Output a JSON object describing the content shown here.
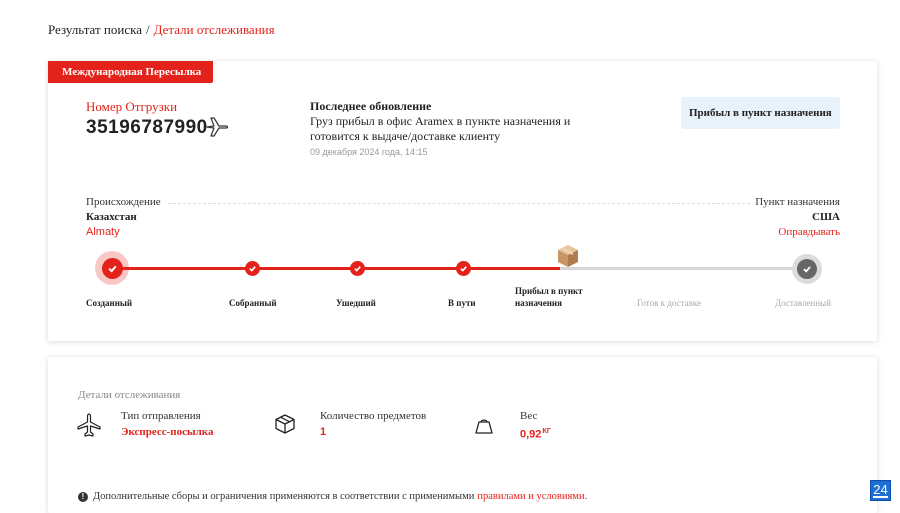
{
  "breadcrumb": {
    "parent": "Результат поиска",
    "separator": "/",
    "current": "Детали отслеживания"
  },
  "shipment_card": {
    "tag": "Международная Пересылка",
    "shipment_label": "Номер Отгрузки",
    "shipment_number": "35196787990",
    "last_update": {
      "title": "Последнее обновление",
      "text": "Груз прибыл в офис Aramex в пункте назначения и готовится к выдаче/доставке клиенту",
      "date": "09 декабря 2024 года, 14:15"
    },
    "status_badge": "Прибыл в пункт назначения",
    "origin": {
      "label": "Происхождение",
      "country": "Казахстан",
      "city": "Almaty"
    },
    "destination": {
      "label": "Пункт назначения",
      "country": "США",
      "city": "Оправдывать"
    },
    "steps": [
      {
        "label": "Созданный",
        "state": "done"
      },
      {
        "label": "Собранный",
        "state": "done"
      },
      {
        "label": "Ушедший",
        "state": "done"
      },
      {
        "label": "В пути",
        "state": "done"
      },
      {
        "label": "Прибыл в пункт назначения",
        "label_line1": "Прибыл в пункт",
        "label_line2": "назначения",
        "state": "current"
      },
      {
        "label": "Готов к доставке",
        "state": "pending"
      },
      {
        "label": "Доставленный",
        "state": "pending"
      }
    ]
  },
  "details_card": {
    "title": "Детали отслеживания",
    "items": [
      {
        "label": "Тип отправления",
        "value": "Экспресс-посылка",
        "icon": "plane-icon"
      },
      {
        "label": "Количество предметов",
        "value": "1",
        "icon": "package-icon"
      },
      {
        "label": "Вес",
        "value": "0,92",
        "unit": "КГ",
        "icon": "weight-icon"
      }
    ],
    "note": {
      "text": "Дополнительные сборы и ограничения применяются в соответствии с применимыми",
      "link": "правилами и условиями."
    }
  },
  "corner_badge": "24",
  "colors": {
    "accent": "#e3231b",
    "badge_bg": "#e8f2fa",
    "pending": "#d6d6d6"
  }
}
